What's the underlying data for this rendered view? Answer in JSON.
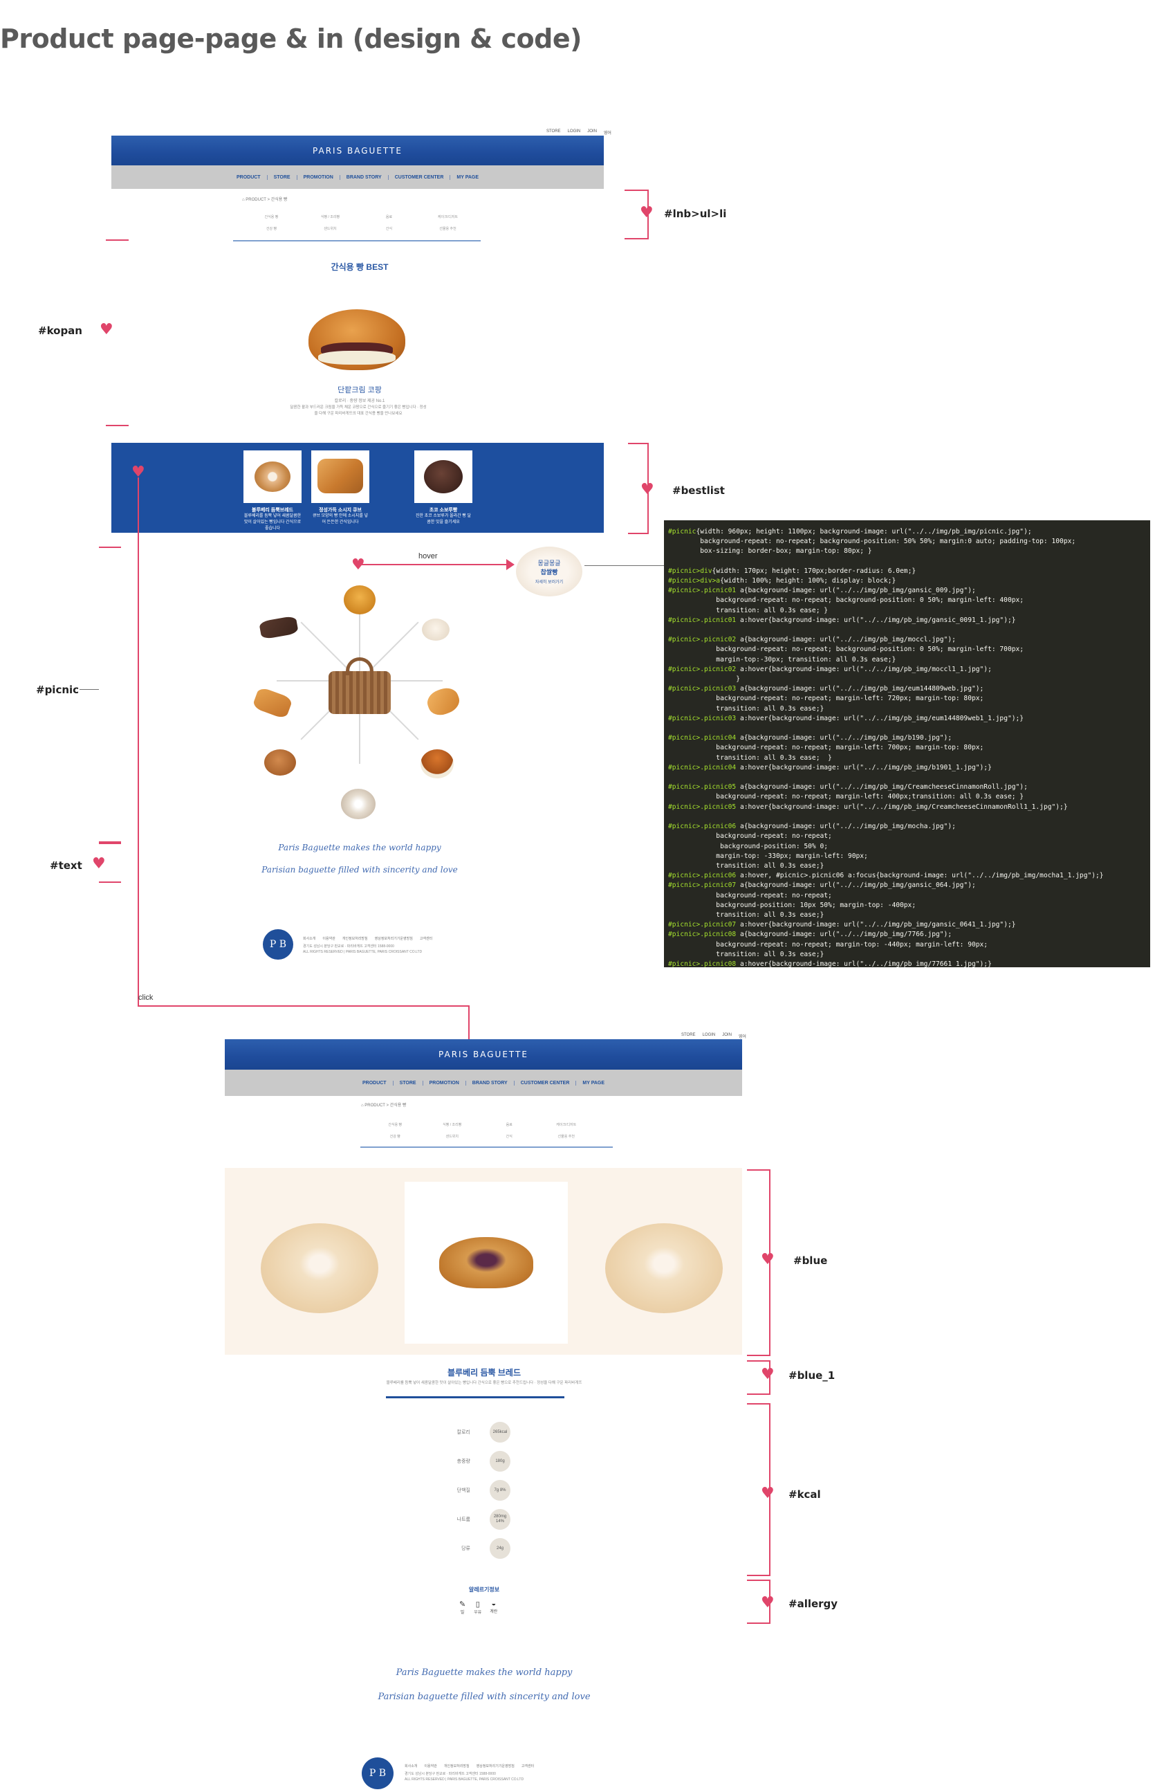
{
  "page_title": "Product page-page & in (design & code)",
  "mockup1": {
    "util_links": [
      "STORE",
      "LOGIN",
      "JOIN",
      "영어"
    ],
    "logo": "PARIS BAGUETTE",
    "gnb": [
      "PRODUCT",
      "STORE",
      "PROMOTION",
      "BRAND STORY",
      "CUSTOMER CENTER",
      "MY PAGE"
    ],
    "breadcrumb": "PRODUCT > 간식용 빵",
    "lnb": [
      "간식용 빵",
      "식빵 / 조리빵",
      "음료",
      "케이크/디저트",
      "건강 빵",
      "샌드위치",
      "간식",
      "선물용 추천"
    ],
    "kopan_title": "간식용 빵 BEST",
    "kopan_name": "단팥크림 코팡",
    "kopan_sub": "칼로리 · 중량 정보 제공 No.1",
    "kopan_desc": "달콤한 팥과 부드러운 크림을 가득 채운 코팡으로 간식으로 즐기기 좋은 빵입니다 · 정성을 다해 구운 파리바게뜨의 대표 간식용 빵을 만나보세요",
    "bestlist": [
      {
        "name": "블루베리 듬뿍브레드",
        "desc": "블루베리를 듬뿍 넣어 새콤달콤한 맛이 살아있는 빵입니다 간식으로 좋습니다"
      },
      {
        "name": "정성가득 소시지 큐브",
        "desc": "큐브 모양의 빵 안에 소시지를 넣어 든든한 간식입니다"
      },
      {
        "name": "초코 소보루빵",
        "desc": "진한 초코 소보루가 올라간 빵 달콤한 맛을 즐기세요"
      }
    ],
    "hover_label": "hover",
    "hover_bubble": [
      "몽글몽글",
      "찹쌀빵",
      "자세히 보러가기"
    ],
    "slogan_1": "Paris Baguette makes the world happy",
    "slogan_2": "Parisian baguette filled with sincerity and love",
    "footer_links": [
      "회사소개",
      "이용약관",
      "개인정보처리방침",
      "영상정보처리기기운영방침",
      "고객센터"
    ],
    "footer_text_1": "경기도 성남시 분당구 판교로 · 파리바게뜨 고객센터 1588-0000",
    "footer_text_2": "ALL RIGHTS RESERVED | PARIS BAGUETTE, PARIS CROISSANT CO.LTD",
    "seal": "P B"
  },
  "annotations": {
    "lnb": "#lnb>ul>li",
    "kopan": "#kopan",
    "bestlist": "#bestlist",
    "picnic": "#picnic",
    "text": "#text",
    "click": "click",
    "blue": "#blue",
    "blue_1": "#blue_1",
    "kcal": "#kcal",
    "allergy": "#allergy"
  },
  "code_lines": [
    "#picnic{width: 960px; height: 1100px; background-image: url(\"../../img/pb_img/picnic.jpg\");",
    "        background-repeat: no-repeat; background-position: 50% 50%; margin:0 auto; padding-top: 100px;",
    "        box-sizing: border-box; margin-top: 80px; }",
    "",
    "#picnic>div{width: 170px; height: 170px;border-radius: 6.0em;}",
    "#picnic>div>a{width: 100%; height: 100%; display: block;}",
    "#picnic>.picnic01 a{background-image: url(\"../../img/pb_img/gansic_009.jpg\");",
    "            background-repeat: no-repeat; background-position: 0 50%; margin-left: 400px;",
    "            transition: all 0.3s ease; }",
    "#picnic>.picnic01 a:hover{background-image: url(\"../../img/pb_img/gansic_0091_1.jpg\");}",
    "",
    "#picnic>.picnic02 a{background-image: url(\"../../img/pb_img/moccl.jpg\");",
    "            background-repeat: no-repeat; background-position: 0 50%; margin-left: 700px;",
    "            margin-top:-30px; transition: all 0.3s ease;}",
    "#picnic>.picnic02 a:hover{background-image: url(\"../../img/pb_img/moccl1_1.jpg\");",
    "                 }",
    "#picnic>.picnic03 a{background-image: url(\"../../img/pb_img/eum144809web.jpg\");",
    "            background-repeat: no-repeat; margin-left: 720px; margin-top: 80px;",
    "            transition: all 0.3s ease;}",
    "#picnic>.picnic03 a:hover{background-image: url(\"../../img/pb_img/eum144809web1_1.jpg\");}",
    "",
    "#picnic>.picnic04 a{background-image: url(\"../../img/pb_img/b190.jpg\");",
    "            background-repeat: no-repeat; margin-left: 700px; margin-top: 80px;",
    "            transition: all 0.3s ease;  }",
    "#picnic>.picnic04 a:hover{background-image: url(\"../../img/pb_img/b1901_1.jpg\");}",
    "",
    "#picnic>.picnic05 a{background-image: url(\"../../img/pb_img/CreamcheeseCinnamonRoll.jpg\");",
    "            background-repeat: no-repeat; margin-left: 400px;transition: all 0.3s ease; }",
    "#picnic>.picnic05 a:hover{background-image: url(\"../../img/pb_img/CreamcheeseCinnamonRoll1_1.jpg\");}",
    "",
    "#picnic>.picnic06 a{background-image: url(\"../../img/pb_img/mocha.jpg\");",
    "            background-repeat: no-repeat;",
    "             background-position: 50% 0;",
    "            margin-top: -330px; margin-left: 90px;",
    "            transition: all 0.3s ease;}",
    "#picnic>.picnic06 a:hover, #picnic>.picnic06 a:focus{background-image: url(\"../../img/pb_img/mocha1_1.jpg\");}",
    "#picnic>.picnic07 a{background-image: url(\"../../img/pb_img/gansic_064.jpg\");",
    "            background-repeat: no-repeat;",
    "            background-position: 10px 50%; margin-top: -400px;",
    "            transition: all 0.3s ease;}",
    "#picnic>.picnic07 a:hover{background-image: url(\"../../img/pb_img/gansic_0641_1.jpg\");}",
    "#picnic>.picnic08 a{background-image: url(\"../../img/pb_img/7766.jpg\");",
    "            background-repeat: no-repeat; margin-top: -440px; margin-left: 90px;",
    "            transition: all 0.3s ease;}",
    "#picnic>.picnic08 a:hover{background-image: url(\"../../img/pb_img/77661_1.jpg\");}"
  ],
  "mockup2": {
    "util_links": [
      "STORE",
      "LOGIN",
      "JOIN",
      "영어"
    ],
    "logo": "PARIS BAGUETTE",
    "gnb": [
      "PRODUCT",
      "STORE",
      "PROMOTION",
      "BRAND STORY",
      "CUSTOMER CENTER",
      "MY PAGE"
    ],
    "breadcrumb": "PRODUCT > 간식용 빵",
    "lnb": [
      "간식용 빵",
      "식빵 / 조리빵",
      "음료",
      "케이크/디저트",
      "건강 빵",
      "샌드위치",
      "간식",
      "선물용 추천"
    ],
    "product_name": "블루베리 듬뿍 브레드",
    "product_desc": "블루베리를 듬뿍 넣어 새콤달콤한 맛이 살아있는 빵입니다 간식으로 좋은 빵으로 추천드립니다 · 정성을 다해 구운 파리바게뜨",
    "nutrition": [
      {
        "label": "칼로리",
        "value": "265kcal"
      },
      {
        "label": "총중량",
        "value": "180g"
      },
      {
        "label": "단백질",
        "value": "7g 8%"
      },
      {
        "label": "나트륨",
        "value": "280mg 14%"
      },
      {
        "label": "당류",
        "value": "24g"
      }
    ],
    "allergy_title": "알레르기정보",
    "allergy_items": [
      {
        "icon": "wheat-icon",
        "label": "밀"
      },
      {
        "icon": "milk-icon",
        "label": "우유"
      },
      {
        "icon": "egg-icon",
        "label": "계란"
      }
    ],
    "slogan_1": "Paris Baguette makes the world happy",
    "slogan_2": "Parisian baguette filled with sincerity and love",
    "footer_links": [
      "회사소개",
      "이용약관",
      "개인정보처리방침",
      "영상정보처리기기운영방침",
      "고객센터"
    ],
    "footer_text_1": "경기도 성남시 분당구 판교로 · 파리바게뜨 고객센터 1588-0000",
    "footer_text_2": "ALL RIGHTS RESERVED | PARIS BAGUETTE, PARIS CROISSANT CO.LTD",
    "seal": "P B"
  },
  "colors": {
    "brand_blue": "#1f4f9a",
    "accent_pink": "#e0456a",
    "cream": "#fbf3ea",
    "code_bg": "#272822"
  }
}
